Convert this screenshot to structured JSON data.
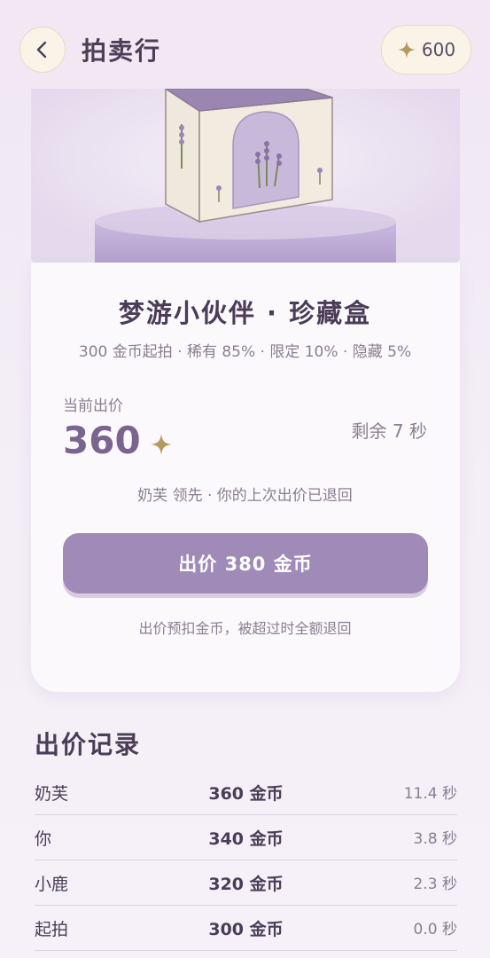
{
  "header": {
    "title": "拍卖行",
    "coins": "600"
  },
  "product": {
    "name": "梦游小伙伴 · 珍藏盒",
    "description": "300 金币起拍 · 稀有 85% · 限定 10% · 隐藏 5%"
  },
  "auction": {
    "current_label": "当前出价",
    "current_price": "360",
    "remaining": "剩余 7 秒",
    "leader_text": "奶芙 领先 · 你的上次出价已退回",
    "bid_button": "出价 380 金币",
    "note": "出价预扣金币，被超过时全额退回"
  },
  "records": {
    "title": "出价记录",
    "rows": [
      {
        "who": "奶芙",
        "amount": "360 金币",
        "time": "11.4 秒"
      },
      {
        "who": "你",
        "amount": "340 金币",
        "time": "3.8 秒"
      },
      {
        "who": "小鹿",
        "amount": "320 金币",
        "time": "2.3 秒"
      },
      {
        "who": "起拍",
        "amount": "300 金币",
        "time": "0.0 秒"
      }
    ]
  },
  "colors": {
    "accent": "#a08ab7",
    "price": "#7a6591",
    "gold": "#b59a5e",
    "background": "#f3edf6"
  },
  "icons": {
    "back": "chevron-left-icon",
    "coin": "sparkle-star-icon"
  }
}
